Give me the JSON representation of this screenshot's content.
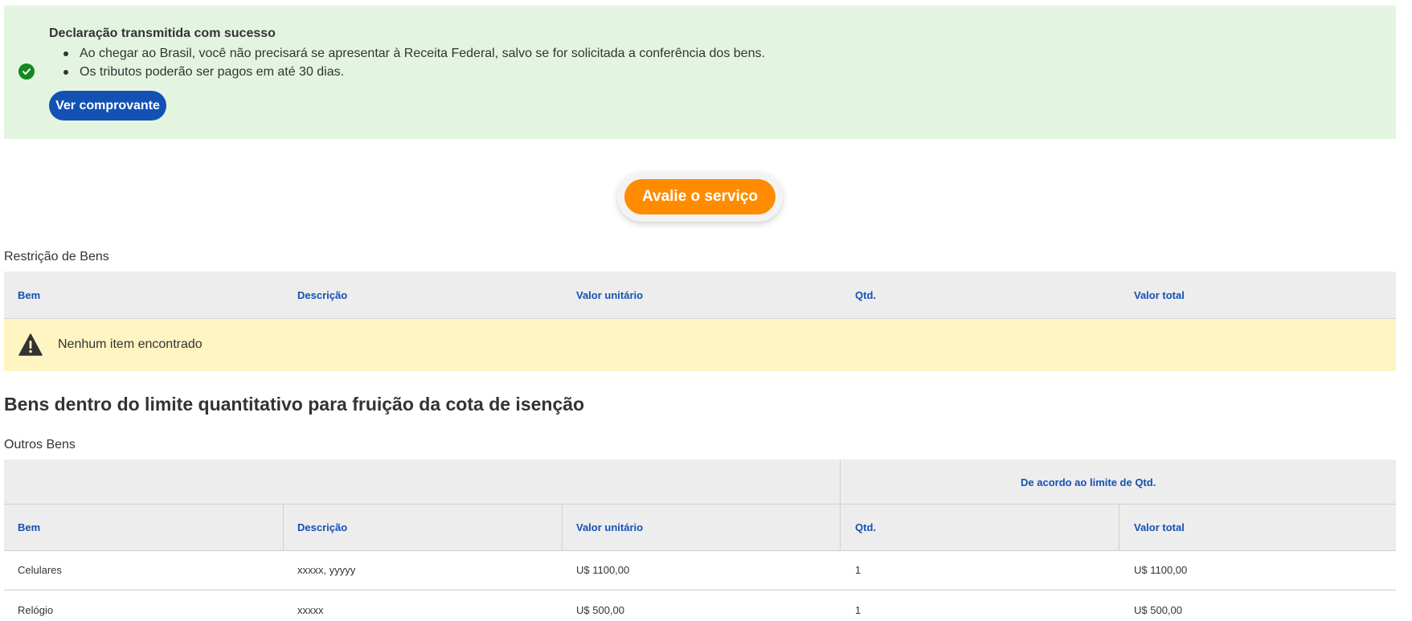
{
  "alert": {
    "title": "Declaração transmitida com sucesso",
    "items": [
      "Ao chegar ao Brasil, você não precisará se apresentar à Receita Federal, salvo se for solicitada a conferência dos bens.",
      "Os tributos poderão ser pagos em até 30 dias."
    ],
    "button_label": "Ver comprovante",
    "icon": "check-circle-icon",
    "color": "#168821"
  },
  "rate_button": {
    "label": "Avalie o serviço",
    "color": "#ff8c00"
  },
  "restricao": {
    "title": "Restrição de Bens",
    "columns": [
      "Bem",
      "Descrição",
      "Valor unitário",
      "Qtd.",
      "Valor total"
    ],
    "empty_message": "Nenhum item encontrado",
    "empty_icon": "warning-icon"
  },
  "cota": {
    "heading": "Bens dentro do limite quantitativo para fruição da cota de isenção",
    "subtitle": "Outros Bens",
    "group_header": "De acordo ao limite de Qtd.",
    "columns": [
      "Bem",
      "Descrição",
      "Valor unitário",
      "Qtd.",
      "Valor total"
    ],
    "rows": [
      {
        "bem": "Celulares",
        "descricao": "xxxxx, yyyyy",
        "valor_unitario": "U$ 1100,00",
        "qtd": "1",
        "valor_total": "U$ 1100,00"
      },
      {
        "bem": "Relógio",
        "descricao": "xxxxx",
        "valor_unitario": "U$ 500,00",
        "qtd": "1",
        "valor_total": "U$ 500,00"
      }
    ]
  },
  "colors": {
    "primary": "#1351b4",
    "success_bg": "#e3f5e1",
    "warning_bg": "#fff5c2"
  }
}
